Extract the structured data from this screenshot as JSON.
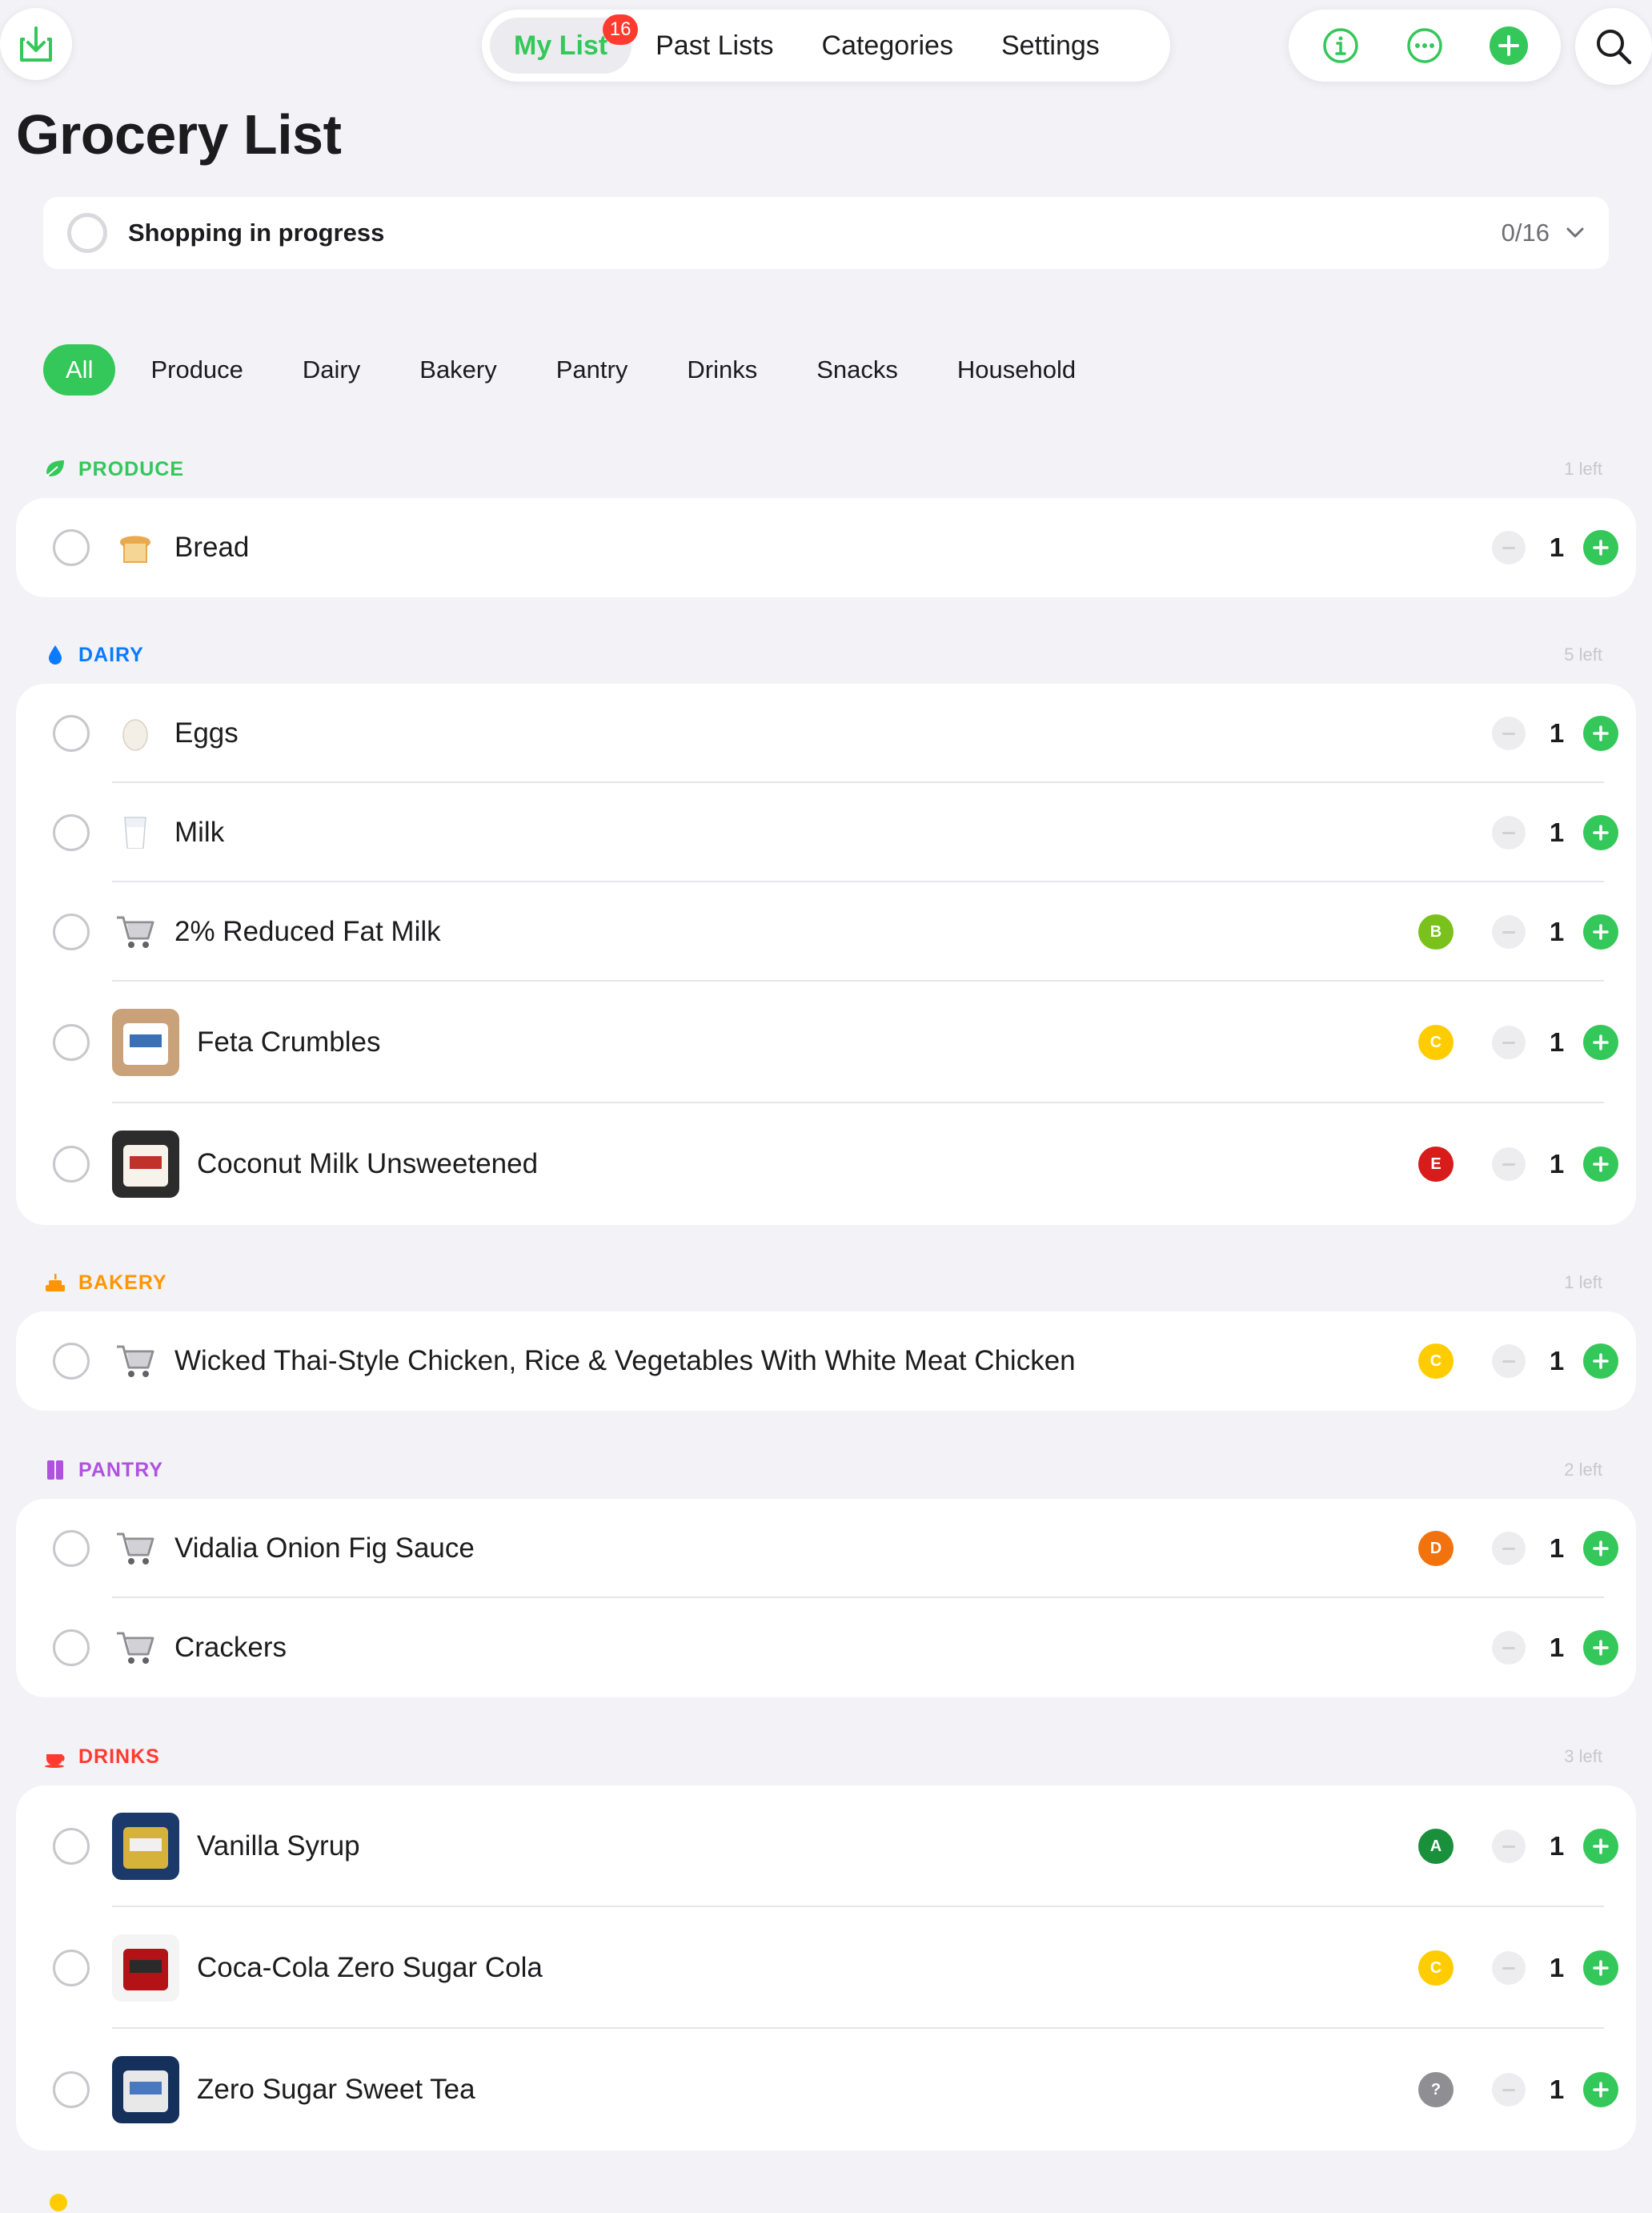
{
  "header": {
    "tabs": [
      {
        "label": "My List",
        "badge": "16",
        "active": true
      },
      {
        "label": "Past Lists"
      },
      {
        "label": "Categories"
      },
      {
        "label": "Settings"
      }
    ],
    "actions": [
      "info-icon",
      "more-icon",
      "add-icon"
    ],
    "left_icon": "download-icon",
    "right_icon": "search-icon"
  },
  "title": "Grocery List",
  "progress": {
    "label": "Shopping in progress",
    "count": "0/16",
    "value": 0
  },
  "filters": [
    "All",
    "Produce",
    "Dairy",
    "Bakery",
    "Pantry",
    "Drinks",
    "Snacks",
    "Household"
  ],
  "colors": {
    "accent": "#34c759",
    "produce": "#34c759",
    "dairy": "#0a7aff",
    "bakery": "#ff9500",
    "pantry": "#af52de",
    "drinks": "#ff3b30"
  },
  "sections": [
    {
      "title": "PRODUCE",
      "left": "1 left",
      "icon": "leaf-icon",
      "items": [
        {
          "name": "Bread",
          "thumb": "bread-emoji",
          "grade": "",
          "qty": "1"
        }
      ]
    },
    {
      "title": "DAIRY",
      "left": "5 left",
      "icon": "drop-icon",
      "items": [
        {
          "name": "Eggs",
          "thumb": "egg-emoji",
          "grade": "",
          "qty": "1"
        },
        {
          "name": "Milk",
          "thumb": "milk-emoji",
          "grade": "",
          "qty": "1"
        },
        {
          "name": "2% Reduced Fat Milk",
          "thumb": "cart-icon",
          "grade": "B",
          "qty": "1"
        },
        {
          "name": "Feta Crumbles",
          "thumb": "product-photo",
          "grade": "C",
          "qty": "1"
        },
        {
          "name": "Coconut Milk Unsweetened",
          "thumb": "product-photo",
          "grade": "E",
          "qty": "1"
        }
      ]
    },
    {
      "title": "BAKERY",
      "left": "1 left",
      "icon": "cake-icon",
      "items": [
        {
          "name": "Wicked Thai-Style Chicken, Rice & Vegetables With White Meat Chicken",
          "thumb": "cart-icon",
          "grade": "C",
          "qty": "1"
        }
      ]
    },
    {
      "title": "PANTRY",
      "left": "2 left",
      "icon": "cabinet-icon",
      "items": [
        {
          "name": "Vidalia Onion Fig Sauce",
          "thumb": "cart-icon",
          "grade": "D",
          "qty": "1"
        },
        {
          "name": "Crackers",
          "thumb": "cart-icon",
          "grade": "",
          "qty": "1"
        }
      ]
    },
    {
      "title": "DRINKS",
      "left": "3 left",
      "icon": "cup-icon",
      "items": [
        {
          "name": "Vanilla Syrup",
          "thumb": "product-photo",
          "grade": "A",
          "qty": "1"
        },
        {
          "name": "Coca-Cola Zero Sugar Cola",
          "thumb": "product-photo",
          "grade": "C",
          "qty": "1"
        },
        {
          "name": "Zero Sugar Sweet Tea",
          "thumb": "product-photo",
          "grade": "?",
          "qty": "1"
        }
      ]
    }
  ]
}
